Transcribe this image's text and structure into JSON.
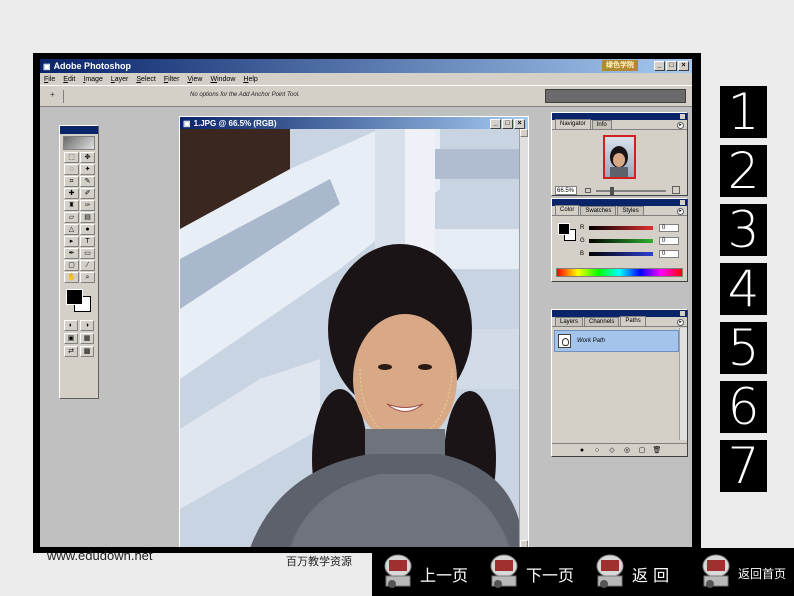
{
  "app": {
    "title": "Adobe Photoshop",
    "badge": "绿色学院",
    "window_buttons": [
      "_",
      "□",
      "×"
    ]
  },
  "menu": [
    "File",
    "Edit",
    "Image",
    "Layer",
    "Select",
    "Filter",
    "View",
    "Window",
    "Help"
  ],
  "options_bar": {
    "tool_glyph": "+",
    "text": "No options for the Add Anchor Point Tool."
  },
  "document": {
    "title": "1.JPG @ 66.5% (RGB)"
  },
  "navigator_panel": {
    "tabs": [
      "Navigator",
      "Info"
    ],
    "zoom": "66.5%"
  },
  "color_panel": {
    "tabs": [
      "Color",
      "Swatches",
      "Styles"
    ],
    "channels": [
      {
        "label": "R",
        "value": "0",
        "color": "#e03030"
      },
      {
        "label": "G",
        "value": "0",
        "color": "#30b030"
      },
      {
        "label": "B",
        "value": "0",
        "color": "#3040d0"
      }
    ]
  },
  "paths_panel": {
    "tabs": [
      "Layers",
      "Channels",
      "Paths"
    ],
    "items": [
      "Work Path"
    ],
    "footer_icons": [
      "●",
      "○",
      "◇",
      "◎",
      "▢",
      "🗑"
    ]
  },
  "step_numbers": [
    "1",
    "2",
    "3",
    "4",
    "5",
    "6",
    "7"
  ],
  "footer": {
    "url": "www.edudown.net",
    "text": "百万教学资源"
  },
  "nav_buttons": [
    {
      "label": "上一页"
    },
    {
      "label": "下一页"
    },
    {
      "label": "返 回"
    },
    {
      "label": "返回首页"
    }
  ]
}
